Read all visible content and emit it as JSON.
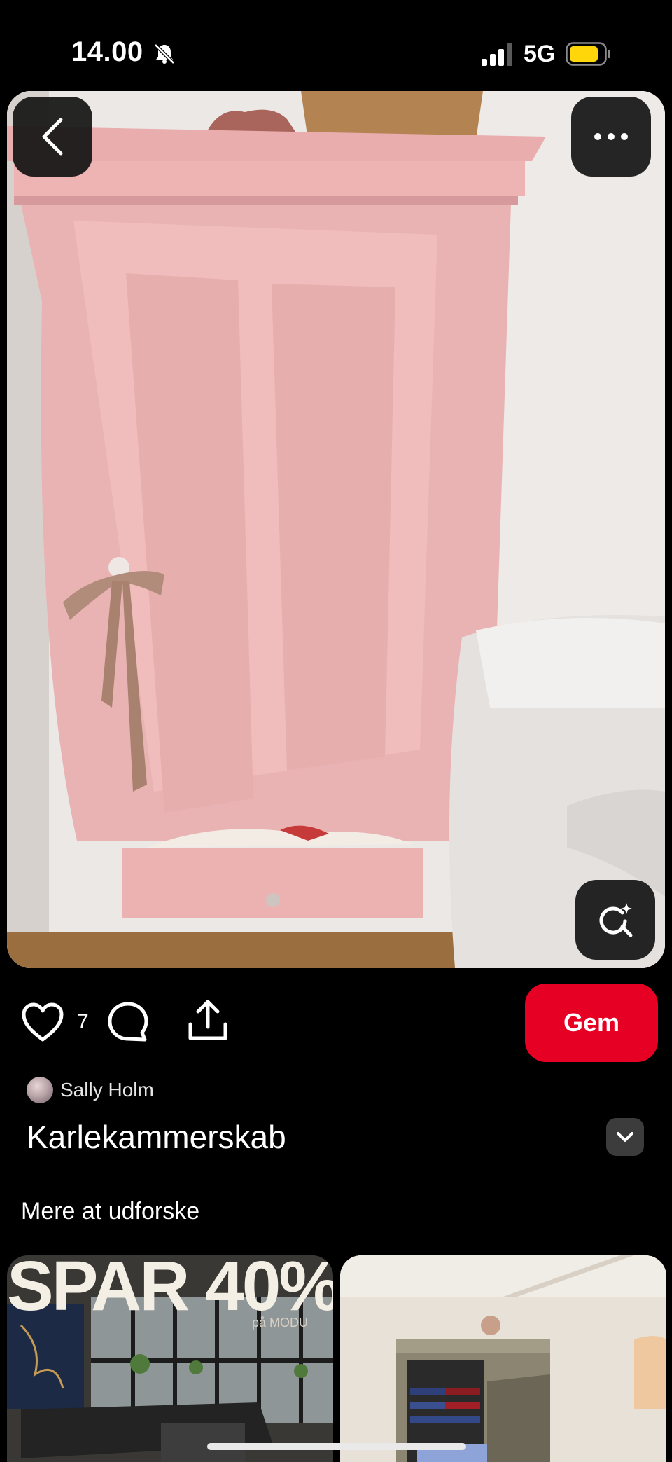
{
  "status_bar": {
    "time": "14.00",
    "network": "5G",
    "icons": [
      "bell-slash-icon",
      "signal-icon",
      "battery-icon"
    ]
  },
  "pin": {
    "buttons": [
      "back-icon",
      "more-icon",
      "visual-search-icon"
    ]
  },
  "actions": {
    "like_count": "7",
    "save_label": "Gem",
    "icons": [
      "heart-icon",
      "comment-icon",
      "share-icon"
    ]
  },
  "creator": {
    "name": "Sally Holm"
  },
  "title": "Karlekammerskab",
  "more": {
    "heading": "Mere at udforske"
  },
  "cards": {
    "left": {
      "headline": "SPAR 40%",
      "subline": "på MODU"
    }
  },
  "colors": {
    "save": "#e60023",
    "background": "#000000",
    "battery": "#ffd60a"
  }
}
